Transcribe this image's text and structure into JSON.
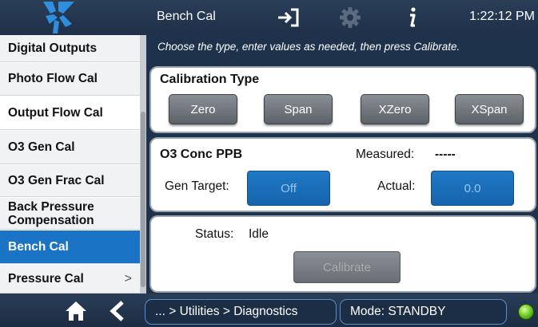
{
  "header": {
    "title": "Bench Cal",
    "time": "1:22:12 PM",
    "icons": [
      "logo-icon",
      "exit-icon",
      "gear-icon",
      "info-icon"
    ]
  },
  "sidebar": {
    "items": [
      {
        "label": "Digital Outputs"
      },
      {
        "label": "Photo Flow Cal"
      },
      {
        "label": "Output Flow Cal"
      },
      {
        "label": "O3 Gen Cal"
      },
      {
        "label": "O3 Gen Frac Cal"
      },
      {
        "label": "Back Pressure Compensation"
      },
      {
        "label": "Bench Cal"
      },
      {
        "label": "Pressure Cal",
        "arrow": ">"
      }
    ],
    "active": "Bench Cal"
  },
  "main": {
    "instruction": "Choose the type, enter values as needed, then press Calibrate.",
    "calibration_type": {
      "title": "Calibration Type",
      "buttons": [
        "Zero",
        "Span",
        "XZero",
        "XSpan"
      ]
    },
    "concentration": {
      "title": "O3 Conc PPB",
      "measured_label": "Measured:",
      "measured_value": "-----",
      "gen_target_label": "Gen Target:",
      "gen_target_value": "Off",
      "actual_label": "Actual:",
      "actual_value": "0.0"
    },
    "status": {
      "label": "Status:",
      "value": "Idle",
      "calibrate_label": "Calibrate"
    }
  },
  "footer": {
    "breadcrumb": "... > Utilities > Diagnostics",
    "mode": "Mode: STANDBY",
    "status_color": "#5fc21a"
  },
  "colors": {
    "accent": "#1a73c4",
    "bar_bg": "#1f3048"
  }
}
